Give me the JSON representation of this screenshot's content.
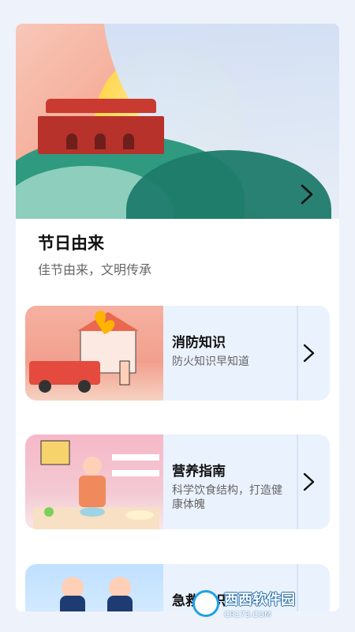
{
  "hero": {
    "title": "节日由来",
    "subtitle": "佳节由来，文明传承",
    "chevron_icon": "chevron-right-icon"
  },
  "cards": [
    {
      "title": "消防知识",
      "subtitle": "防火知识早知道",
      "illustration": "fire-fighting-illustration"
    },
    {
      "title": "营养指南",
      "subtitle": "科学饮食结构，打造健康体魄",
      "illustration": "nutrition-kitchen-illustration"
    },
    {
      "title": "急救知识",
      "subtitle": "",
      "illustration": "first-aid-illustration"
    }
  ],
  "watermark": {
    "name": "西西软件园",
    "url": "CR173.COM"
  },
  "colors": {
    "accent": "#eaf2fe",
    "title": "#111111",
    "subtitle": "#666666"
  }
}
